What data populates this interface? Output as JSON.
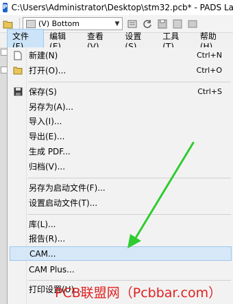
{
  "window": {
    "icon": "pads-app-icon",
    "title": "C:\\Users\\Administrator\\Desktop\\stm32.pcb* - PADS La"
  },
  "toolbar": {
    "layer_select_value": "(V) Bottom"
  },
  "menubar": {
    "items": [
      "文件(F)",
      "编辑(E)",
      "查看(V)",
      "设置(S)",
      "工具(T)",
      "帮助(H)"
    ],
    "active_index": 0
  },
  "file_menu": {
    "items": [
      {
        "label": "新建(N)",
        "shortcut": "Ctrl+N",
        "icon": "new-file-icon"
      },
      {
        "label": "打开(O)...",
        "shortcut": "Ctrl+O",
        "icon": "open-folder-icon"
      },
      {
        "label": "保存(S)",
        "shortcut": "Ctrl+S",
        "icon": "save-disk-icon"
      },
      {
        "label": "另存为(A)...",
        "shortcut": ""
      },
      {
        "label": "导入(I)...",
        "shortcut": ""
      },
      {
        "label": "导出(E)...",
        "shortcut": ""
      },
      {
        "label": "生成 PDF...",
        "shortcut": ""
      },
      {
        "label": "归档(V)...",
        "shortcut": ""
      },
      {
        "label": "另存为启动文件(F)...",
        "shortcut": ""
      },
      {
        "label": "设置启动文件(T)...",
        "shortcut": ""
      },
      {
        "label": "库(L)...",
        "shortcut": ""
      },
      {
        "label": "报告(R)...",
        "shortcut": ""
      },
      {
        "label": "CAM...",
        "shortcut": ""
      },
      {
        "label": "CAM Plus...",
        "shortcut": ""
      },
      {
        "label": "打印设置(U)...",
        "shortcut": ""
      }
    ],
    "highlighted_index": 12
  },
  "watermark": {
    "text": "PCB联盟网（Pcbbar.com）",
    "color": "#e02020"
  },
  "colors": {
    "menu_highlight": "#d6e8f8",
    "arrow": "#2ecc2e"
  }
}
